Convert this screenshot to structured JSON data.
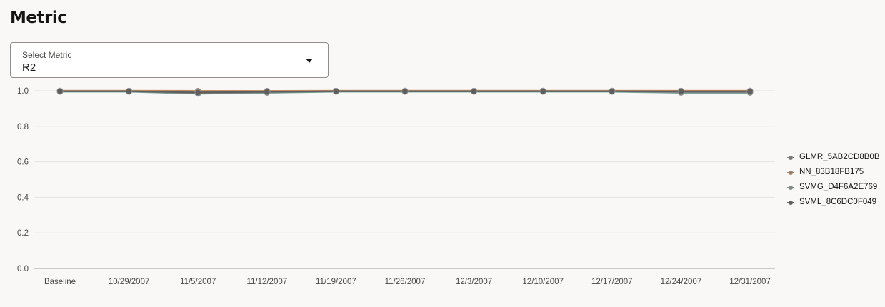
{
  "header": {
    "title": "Metric"
  },
  "metric_select": {
    "label": "Select Metric",
    "value": "R2"
  },
  "colors": {
    "GLMR_5AB2CD8B0B": "#7a7a7a",
    "NN_83B18FB175": "#a57d5c",
    "SVMG_D4F6A2E769": "#7f8c8a",
    "SVML_8C6DC0F049": "#5f5f5f",
    "gridline": "#e6e4e1",
    "axis": "#9e9c98"
  },
  "chart_data": {
    "type": "line",
    "title": "",
    "xlabel": "",
    "ylabel": "",
    "x": [
      "Baseline",
      "10/29/2007",
      "11/5/2007",
      "11/12/2007",
      "11/19/2007",
      "11/26/2007",
      "12/3/2007",
      "12/10/2007",
      "12/17/2007",
      "12/24/2007",
      "12/31/2007"
    ],
    "ylim": [
      0,
      1.0
    ],
    "yticks": [
      "0.0",
      "0.2",
      "0.4",
      "0.6",
      "0.8",
      "1.0"
    ],
    "grid": true,
    "legend_position": "right",
    "series": [
      {
        "name": "GLMR_5AB2CD8B0B",
        "values": [
          0.998,
          0.998,
          0.995,
          0.997,
          0.998,
          0.998,
          0.998,
          0.998,
          0.998,
          0.997,
          0.998
        ]
      },
      {
        "name": "NN_83B18FB175",
        "values": [
          0.999,
          0.999,
          0.998,
          0.998,
          0.999,
          0.999,
          0.999,
          0.999,
          0.999,
          0.999,
          0.999
        ]
      },
      {
        "name": "SVMG_D4F6A2E769",
        "values": [
          0.996,
          0.996,
          0.985,
          0.99,
          0.996,
          0.996,
          0.996,
          0.996,
          0.996,
          0.99,
          0.99
        ]
      },
      {
        "name": "SVML_8C6DC0F049",
        "values": [
          0.997,
          0.997,
          0.99,
          0.994,
          0.997,
          0.997,
          0.997,
          0.997,
          0.997,
          0.996,
          0.996
        ]
      }
    ]
  }
}
